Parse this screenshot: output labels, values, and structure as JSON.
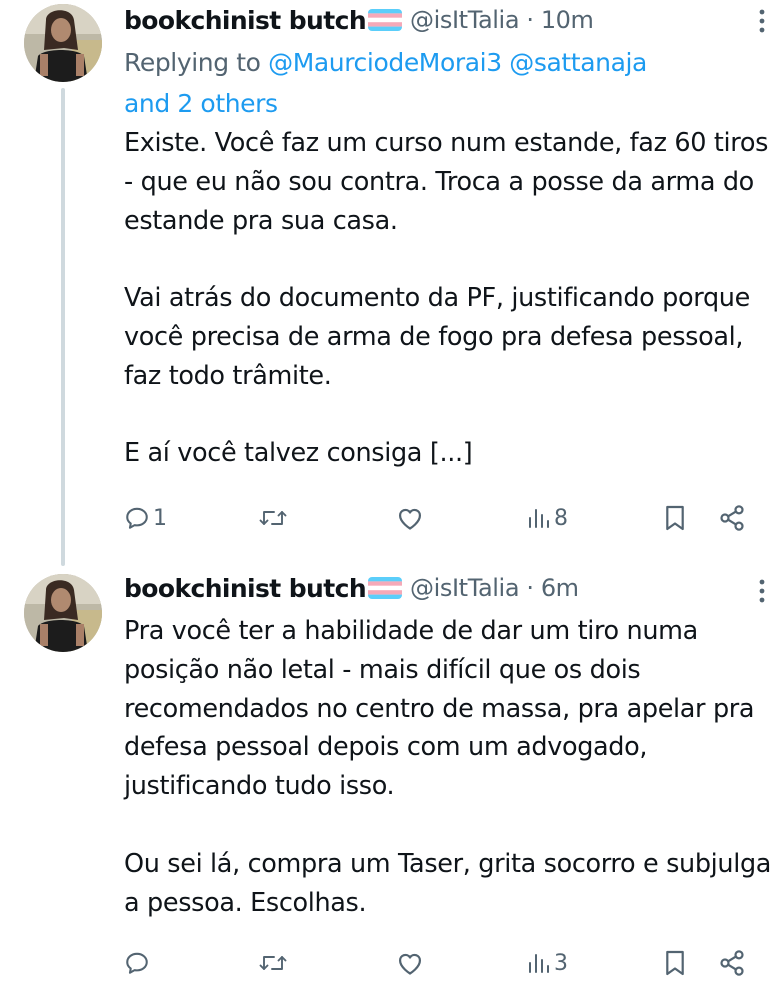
{
  "colors": {
    "text": "#0f1419",
    "secondary": "#536471",
    "link": "#1d9bf0",
    "thread_line": "#cfd9de"
  },
  "tweets": [
    {
      "display_name": "bookchinist butch",
      "name_flag": "transgender-flag",
      "handle_time": "@isItTalia · 10m",
      "reply_prefix": "Replying to ",
      "reply_mentions": "@MaurciodeMorai3 @sattanaja",
      "reply_suffix": "and 2 others",
      "paragraphs": [
        "Existe. Você faz um curso num estande, faz 60 tiros - que eu não sou contra. Troca a posse da arma do estande pra sua casa.",
        "Vai atrás do documento da PF, justificando porque você precisa de arma de fogo pra defesa pessoal, faz todo trâmite.",
        "E aí você talvez consiga [...]"
      ],
      "replies": "1",
      "views": "8"
    },
    {
      "display_name": "bookchinist butch",
      "name_flag": "transgender-flag",
      "handle_time": "@isItTalia · 6m",
      "paragraphs": [
        "Pra você ter a habilidade de dar um tiro numa posição não letal - mais difícil que os dois recomendados no centro de massa, pra apelar pra defesa pessoal depois com um advogado, justificando tudo isso.",
        "Ou sei lá, compra um Taser, grita socorro e subjulga a pessoa. Escolhas."
      ],
      "views": "3"
    }
  ]
}
